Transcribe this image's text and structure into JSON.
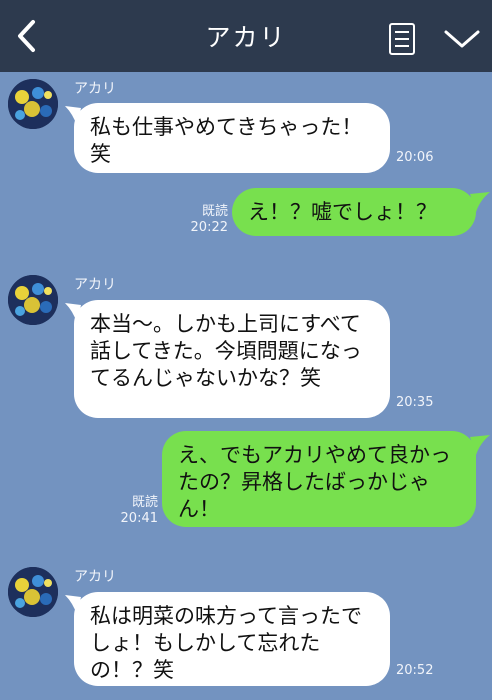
{
  "header": {
    "title": "アカリ",
    "back_icon": "chevron-left-icon",
    "menu_icon": "menu-list-icon",
    "expand_icon": "chevron-down-icon"
  },
  "colors": {
    "background": "#7393c0",
    "header": "#2d3a4e",
    "incoming_bubble": "#ffffff",
    "outgoing_bubble": "#78e04e"
  },
  "messages": [
    {
      "sender": "アカリ",
      "direction": "in",
      "text": "私も仕事やめてきちゃった！笑",
      "time": "20:06"
    },
    {
      "direction": "out",
      "text": "え！？嘘でしょ！？",
      "read": "既読",
      "time": "20:22"
    },
    {
      "sender": "アカリ",
      "direction": "in",
      "text": "本当〜。しかも上司にすべて話してきた。今頃問題になってるんじゃないかな？笑",
      "time": "20:35"
    },
    {
      "direction": "out",
      "text": "え、でもアカリやめて良かったの？昇格したばっかじゃん！",
      "read": "既読",
      "time": "20:41"
    },
    {
      "sender": "アカリ",
      "direction": "in",
      "text": "私は明菜の味方って言ったでしょ！もしかして忘れたの！？笑",
      "time": "20:52"
    }
  ]
}
